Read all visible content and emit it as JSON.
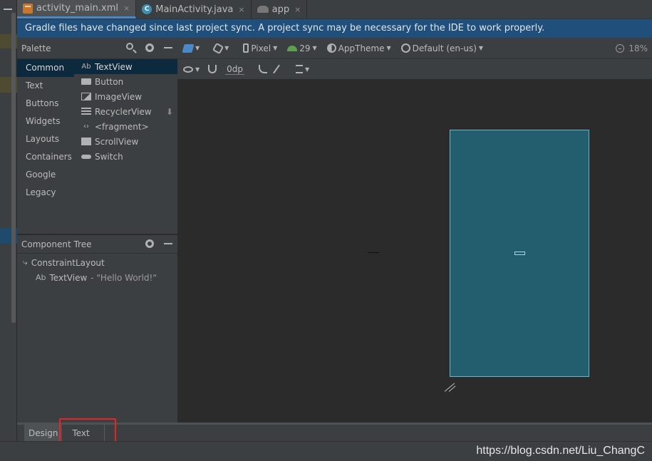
{
  "tabs": [
    {
      "label": "activity_main.xml",
      "icon": "xml-file-icon",
      "active": true
    },
    {
      "label": "MainActivity.java",
      "icon": "class-icon",
      "active": false
    },
    {
      "label": "app",
      "icon": "android-module-icon",
      "active": false
    }
  ],
  "close_glyph": "×",
  "notification": "Gradle files have changed since last project sync. A project sync may be necessary for the IDE to work properly.",
  "palette": {
    "title": "Palette",
    "categories": [
      "Common",
      "Text",
      "Buttons",
      "Widgets",
      "Layouts",
      "Containers",
      "Google",
      "Legacy"
    ],
    "widgets": [
      {
        "label": "TextView",
        "icon": "textview-icon"
      },
      {
        "label": "Button",
        "icon": "button-icon"
      },
      {
        "label": "ImageView",
        "icon": "imageview-icon"
      },
      {
        "label": "RecyclerView",
        "icon": "recyclerview-icon"
      },
      {
        "label": "<fragment>",
        "icon": "fragment-icon"
      },
      {
        "label": "ScrollView",
        "icon": "scrollview-icon"
      },
      {
        "label": "Switch",
        "icon": "switch-icon"
      }
    ]
  },
  "component_tree": {
    "title": "Component Tree",
    "root": "ConstraintLayout",
    "child_label": "TextView",
    "child_hint": "- \"Hello World!\""
  },
  "toolbar": {
    "device": "Pixel",
    "api": "29",
    "theme": "AppTheme",
    "locale": "Default (en-us)",
    "zoom": "18%",
    "margin": "0dp",
    "ab_glyph": "Ab"
  },
  "bottom_tabs": {
    "design": "Design",
    "text": "Text"
  },
  "watermark": "https://blog.csdn.net/Liu_ChangC",
  "colors": {
    "accent": "#4a88c7",
    "notification": "#1f4f7a",
    "device": "#225e6e",
    "highlight": "#e8242a"
  }
}
